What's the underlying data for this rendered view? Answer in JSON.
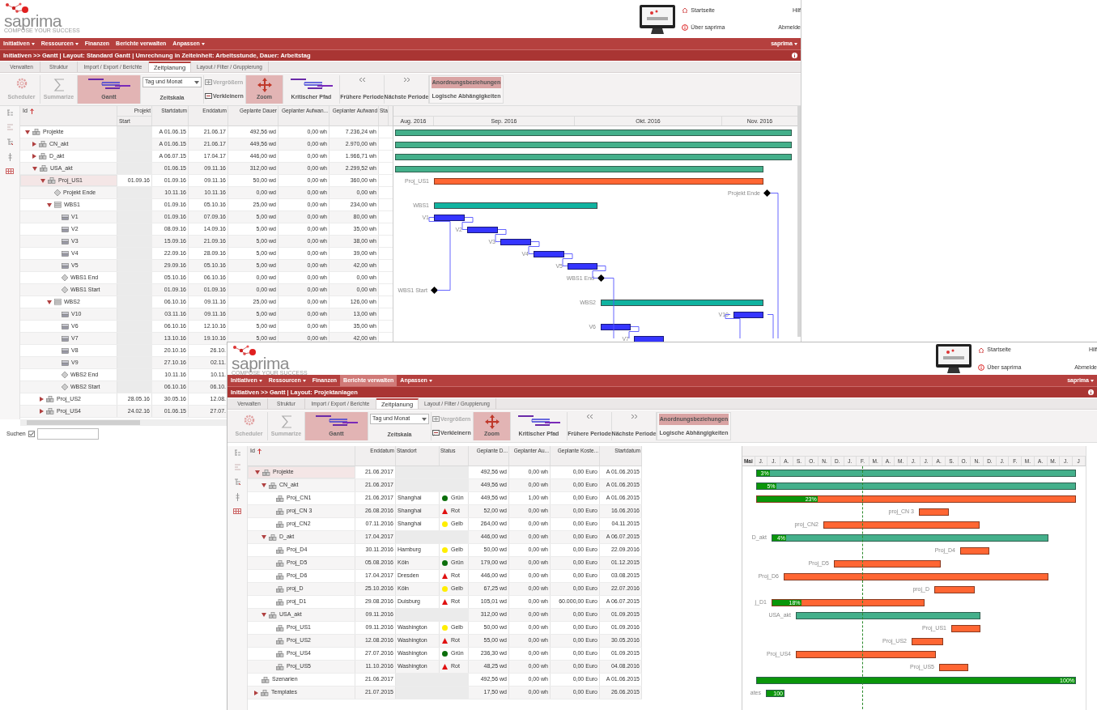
{
  "windows": [
    {
      "logo": {
        "name": "saprima",
        "tagline": "COMPOSE YOUR SUCCESS"
      },
      "header_links": [
        "Startseite",
        "Über saprima"
      ],
      "right_links": [
        "Hilf",
        "Abmelde"
      ],
      "menu": [
        {
          "label": "Initiativen",
          "dropdown": true,
          "selected": false
        },
        {
          "label": "Ressourcen",
          "dropdown": true,
          "selected": false
        },
        {
          "label": "Finanzen",
          "dropdown": false,
          "selected": false
        },
        {
          "label": "Berichte verwalten",
          "dropdown": false,
          "selected": false
        },
        {
          "label": "Anpassen",
          "dropdown": true,
          "selected": false
        }
      ],
      "user_menu": "saprima",
      "breadcrumb": "Initiativen >> Gantt | Layout: Standard Gantt | Umrechnung in Zeiteinheit: Arbeitsstunde, Dauer: Arbeitstag",
      "tabs": [
        {
          "label": "Verwalten",
          "selected": false
        },
        {
          "label": "Struktur",
          "selected": false
        },
        {
          "label": "Import / Export / Berichte",
          "selected": false
        },
        {
          "label": "Zeitplanung",
          "selected": true
        },
        {
          "label": "Layout / Filter / Gruppierung",
          "selected": false
        }
      ],
      "ribbon": [
        {
          "kind": "large",
          "label": "Scheduler",
          "disabled": true,
          "pressed": false
        },
        {
          "kind": "large",
          "label": "Summarize",
          "disabled": true,
          "pressed": false
        },
        {
          "kind": "large",
          "label": "Gantt",
          "disabled": false,
          "pressed": true
        },
        {
          "kind": "select",
          "value": "Tag und Monat",
          "label": "Zeitskala"
        },
        {
          "kind": "pair",
          "items": [
            {
              "label": "Vergrößern",
              "disabled": true
            },
            {
              "label": "Verkleinern",
              "disabled": false
            }
          ]
        },
        {
          "kind": "large",
          "label": "Zoom",
          "disabled": false,
          "pressed": true
        },
        {
          "kind": "large",
          "label": "Kritischer Pfad",
          "disabled": false,
          "pressed": false
        },
        {
          "kind": "large",
          "label": "Frühere Periode",
          "disabled": false,
          "pressed": false
        },
        {
          "kind": "large",
          "label": "Nächste Periode",
          "disabled": false,
          "pressed": false
        },
        {
          "kind": "stack",
          "items": [
            {
              "label": "Anordnungsbeziehungen",
              "pressed": true
            },
            {
              "label": "Logische Abhängigkeiten",
              "pressed": false
            }
          ]
        }
      ],
      "table": {
        "tree_column": {
          "label": "Id",
          "sorted": true
        },
        "columns": [
          {
            "label": "Projekt",
            "sublabel": "Start"
          },
          {
            "label": "Startdatum"
          },
          {
            "label": "Enddatum"
          },
          {
            "label": "Geplante Dauer"
          },
          {
            "label": "Geplanter Aufwan..."
          },
          {
            "label": "Geplanter Aufwand"
          },
          {
            "label": "Sta"
          }
        ],
        "rows": [
          {
            "id": "Projekte",
            "kind": "project",
            "expanded": true,
            "selected": false,
            "cells": [
              null,
              "A 01.06.15",
              "21.06.17",
              "492,56 wd",
              "0,00 wh",
              "7.236,24 wh"
            ],
            "bar": {
              "kind": "summary"
            },
            "children": [
              {
                "id": "CN_akt",
                "kind": "project",
                "expanded": false,
                "selected": false,
                "cells": [
                  null,
                  "A 01.06.15",
                  "21.06.17",
                  "449,56 wd",
                  "0,00 wh",
                  "2.970,00 wh"
                ],
                "bar": {
                  "kind": "summary"
                }
              },
              {
                "id": "D_akt",
                "kind": "project",
                "expanded": false,
                "selected": false,
                "cells": [
                  null,
                  "A 06.07.15",
                  "17.04.17",
                  "446,00 wd",
                  "0,00 wh",
                  "1.966,71 wh"
                ],
                "bar": {
                  "kind": "summary"
                }
              },
              {
                "id": "USA_akt",
                "kind": "project",
                "expanded": true,
                "selected": false,
                "cells": [
                  null,
                  "01.06.15",
                  "09.11.16",
                  "312,00 wd",
                  "0,00 wh",
                  "2.299,52 wh"
                ],
                "bar": {
                  "kind": "summary"
                },
                "children": [
                  {
                    "id": "Proj_US1",
                    "kind": "project",
                    "expanded": true,
                    "selected": true,
                    "cells": [
                      "01.09.16",
                      "01.09.16",
                      "09.11.16",
                      "50,00 wd",
                      "0,00 wh",
                      "360,00 wh"
                    ],
                    "bar": {
                      "kind": "project",
                      "label": "Proj_US1"
                    },
                    "children": [
                      {
                        "id": "Projekt Ende",
                        "kind": "milestone",
                        "selected": false,
                        "cells": [
                          null,
                          "10.11.16",
                          "10.11.16",
                          "0,00 wd",
                          "0,00 wh",
                          "0,00 wh"
                        ],
                        "bar": {
                          "kind": "milestone",
                          "label": "Projekt Ende"
                        }
                      },
                      {
                        "id": "WBS1",
                        "kind": "wbs",
                        "expanded": true,
                        "selected": false,
                        "cells": [
                          null,
                          "01.09.16",
                          "05.10.16",
                          "25,00 wd",
                          "0,00 wh",
                          "234,00 wh"
                        ],
                        "bar": {
                          "kind": "wbs",
                          "label": "WBS1"
                        },
                        "children": [
                          {
                            "id": "V1",
                            "kind": "task",
                            "selected": false,
                            "cells": [
                              null,
                              "01.09.16",
                              "07.09.16",
                              "5,00 wd",
                              "0,00 wh",
                              "80,00 wh"
                            ],
                            "bar": {
                              "kind": "task",
                              "label": "V1"
                            }
                          },
                          {
                            "id": "V2",
                            "kind": "task",
                            "selected": false,
                            "cells": [
                              null,
                              "08.09.16",
                              "14.09.16",
                              "5,00 wd",
                              "0,00 wh",
                              "35,00 wh"
                            ],
                            "bar": {
                              "kind": "task",
                              "label": "V2"
                            }
                          },
                          {
                            "id": "V3",
                            "kind": "task",
                            "selected": false,
                            "cells": [
                              null,
                              "15.09.16",
                              "21.09.16",
                              "5,00 wd",
                              "0,00 wh",
                              "38,00 wh"
                            ],
                            "bar": {
                              "kind": "task",
                              "label": "V3"
                            }
                          },
                          {
                            "id": "V4",
                            "kind": "task",
                            "selected": false,
                            "cells": [
                              null,
                              "22.09.16",
                              "28.09.16",
                              "5,00 wd",
                              "0,00 wh",
                              "39,00 wh"
                            ],
                            "bar": {
                              "kind": "task",
                              "label": "V4"
                            }
                          },
                          {
                            "id": "V5",
                            "kind": "task",
                            "selected": false,
                            "cells": [
                              null,
                              "29.09.16",
                              "05.10.16",
                              "5,00 wd",
                              "0,00 wh",
                              "42,00 wh"
                            ],
                            "bar": {
                              "kind": "task",
                              "label": "V5"
                            }
                          },
                          {
                            "id": "WBS1 End",
                            "kind": "milestone",
                            "selected": false,
                            "cells": [
                              null,
                              "05.10.16",
                              "06.10.16",
                              "0,00 wd",
                              "0,00 wh",
                              "0,00 wh"
                            ],
                            "bar": {
                              "kind": "milestone",
                              "label": "WBS1 End"
                            }
                          },
                          {
                            "id": "WBS1 Start",
                            "kind": "milestone",
                            "selected": false,
                            "cells": [
                              null,
                              "01.09.16",
                              "01.09.16",
                              "0,00 wd",
                              "0,00 wh",
                              "0,00 wh"
                            ],
                            "bar": {
                              "kind": "milestone",
                              "label": "WBS1 Start"
                            }
                          }
                        ]
                      },
                      {
                        "id": "WBS2",
                        "kind": "wbs",
                        "expanded": true,
                        "selected": false,
                        "cells": [
                          null,
                          "06.10.16",
                          "09.11.16",
                          "25,00 wd",
                          "0,00 wh",
                          "126,00 wh"
                        ],
                        "bar": {
                          "kind": "wbs",
                          "label": "WBS2"
                        },
                        "children": [
                          {
                            "id": "V10",
                            "kind": "task",
                            "selected": false,
                            "cells": [
                              null,
                              "03.11.16",
                              "09.11.16",
                              "5,00 wd",
                              "0,00 wh",
                              "13,00 wh"
                            ],
                            "bar": {
                              "kind": "task",
                              "label": "V10"
                            }
                          },
                          {
                            "id": "V6",
                            "kind": "task",
                            "selected": false,
                            "cells": [
                              null,
                              "06.10.16",
                              "12.10.16",
                              "5,00 wd",
                              "0,00 wh",
                              "35,00 wh"
                            ],
                            "bar": {
                              "kind": "task",
                              "label": "V6"
                            }
                          },
                          {
                            "id": "V7",
                            "kind": "task",
                            "selected": false,
                            "cells": [
                              null,
                              "13.10.16",
                              "19.10.16",
                              "5,00 wd",
                              "0,00 wh",
                              "42,00 wh"
                            ],
                            "bar": {
                              "kind": "task",
                              "label": "V7"
                            }
                          },
                          {
                            "id": "V8",
                            "kind": "task",
                            "selected": false,
                            "cells": [
                              null,
                              "20.10.16",
                              "26.10."
                            ]
                          },
                          {
                            "id": "V9",
                            "kind": "task",
                            "selected": false,
                            "cells": [
                              null,
                              "27.10.16",
                              "02.11."
                            ]
                          },
                          {
                            "id": "WBS2 End",
                            "kind": "milestone",
                            "selected": false,
                            "cells": [
                              null,
                              "10.11.16",
                              "10.11."
                            ]
                          },
                          {
                            "id": "WBS2 Start",
                            "kind": "milestone",
                            "selected": false,
                            "cells": [
                              null,
                              "06.10.16",
                              "06.10."
                            ]
                          }
                        ]
                      }
                    ]
                  },
                  {
                    "id": "Proj_US2",
                    "kind": "project",
                    "expanded": false,
                    "selected": false,
                    "cells": [
                      "28.05.16",
                      "30.05.16",
                      "12.08."
                    ]
                  },
                  {
                    "id": "Proj_US4",
                    "kind": "project",
                    "expanded": false,
                    "selected": false,
                    "cells": [
                      "24.02.16",
                      "01.06.15",
                      "27.07."
                    ]
                  }
                ]
              }
            ]
          }
        ]
      },
      "gantt": {
        "months": [
          "Aug. 2016",
          "Sep. 2016",
          "Okt. 2016",
          "Nov. 2016"
        ]
      },
      "search": {
        "label": "Suchen",
        "checked": true
      }
    },
    {
      "logo": {
        "name": "saprima",
        "tagline": "COMPOSE YOUR SUCCESS"
      },
      "header_links": [
        "Startseite",
        "Über saprima"
      ],
      "right_links": [
        "Hilf",
        "Abmelde"
      ],
      "menu": [
        {
          "label": "Initiativen",
          "dropdown": true,
          "selected": false
        },
        {
          "label": "Ressourcen",
          "dropdown": true,
          "selected": false
        },
        {
          "label": "Finanzen",
          "dropdown": false,
          "selected": false
        },
        {
          "label": "Berichte verwalten",
          "dropdown": false,
          "selected": true
        },
        {
          "label": "Anpassen",
          "dropdown": true,
          "selected": false
        }
      ],
      "user_menu": "saprima",
      "breadcrumb": "Initiativen >> Gantt | Layout: Projektanlagen",
      "tabs": [
        {
          "label": "Verwalten",
          "selected": false
        },
        {
          "label": "Struktur",
          "selected": false
        },
        {
          "label": "Import / Export / Berichte",
          "selected": false
        },
        {
          "label": "Zeitplanung",
          "selected": true
        },
        {
          "label": "Layout / Filter / Gruppierung",
          "selected": false
        }
      ],
      "ribbon": [
        {
          "kind": "large",
          "label": "Scheduler",
          "disabled": true,
          "pressed": false
        },
        {
          "kind": "large",
          "label": "Summarize",
          "disabled": true,
          "pressed": false
        },
        {
          "kind": "large",
          "label": "Gantt",
          "disabled": false,
          "pressed": true
        },
        {
          "kind": "select",
          "value": "Tag und Monat",
          "label": "Zeitskala"
        },
        {
          "kind": "pair",
          "items": [
            {
              "label": "Vergrößern",
              "disabled": true
            },
            {
              "label": "Verkleinern",
              "disabled": false
            }
          ]
        },
        {
          "kind": "large",
          "label": "Zoom",
          "disabled": false,
          "pressed": true
        },
        {
          "kind": "large",
          "label": "Kritischer Pfad",
          "disabled": false,
          "pressed": false
        },
        {
          "kind": "large",
          "label": "Frühere Periode",
          "disabled": false,
          "pressed": false
        },
        {
          "kind": "large",
          "label": "Nächste Periode",
          "disabled": false,
          "pressed": false
        },
        {
          "kind": "stack",
          "items": [
            {
              "label": "Anordnungsbeziehungen",
              "pressed": true
            },
            {
              "label": "Logische Abhängigkeiten",
              "pressed": false
            }
          ]
        }
      ],
      "table": {
        "tree_column": {
          "label": "Id",
          "sorted": true
        },
        "columns": [
          {
            "label": "Enddatum"
          },
          {
            "label": "Standort"
          },
          {
            "label": "Status"
          },
          {
            "label": "Geplante D..."
          },
          {
            "label": "Geplanter Au..."
          },
          {
            "label": "Geplante Koste..."
          },
          {
            "label": "Startdatum"
          }
        ],
        "rows": [
          {
            "id": "Projekte",
            "kind": "project",
            "expanded": true,
            "selected": true,
            "cells": [
              "21.06.2017",
              null,
              null,
              "492,56 wd",
              "0,00 wh",
              "0,00 Euro",
              "A 01.06.2015"
            ],
            "bar": {
              "kind": "summary",
              "level": 0.04,
              "progress": "3%"
            },
            "children": [
              {
                "id": "CN_akt",
                "kind": "project",
                "expanded": true,
                "selected": false,
                "cells": [
                  "21.06.2017",
                  null,
                  null,
                  "449,56 wd",
                  "0,00 wh",
                  "0,00 Euro",
                  "A 01.06.2015"
                ],
                "bar": {
                  "kind": "summary",
                  "level": 0.06,
                  "progress": "5%"
                },
                "children": [
                  {
                    "id": "Proj_CN1",
                    "kind": "project",
                    "selected": false,
                    "cells": [
                      "21.06.2017",
                      "Shanghai",
                      {
                        "label": "Grün",
                        "kind": "circle",
                        "color": "#0b6e0b"
                      },
                      "449,56 wd",
                      "1,00 wh",
                      "0,00 Euro",
                      "A 01.06.2015"
                    ],
                    "bar": {
                      "kind": "project",
                      "level": 0.19,
                      "progress": "23%"
                    }
                  },
                  {
                    "id": "proj_CN 3",
                    "kind": "project",
                    "selected": false,
                    "cells": [
                      "26.08.2016",
                      "Shanghai",
                      {
                        "label": "Rot",
                        "kind": "triangle",
                        "color": "#e01010"
                      },
                      "52,00 wd",
                      "0,00 wh",
                      "0,00 Euro",
                      "16.06.2016"
                    ],
                    "bar": {
                      "kind": "project",
                      "label": "proj_CN 3"
                    }
                  },
                  {
                    "id": "proj_CN2",
                    "kind": "project",
                    "selected": false,
                    "cells": [
                      "07.11.2016",
                      "Shanghai",
                      {
                        "label": "Gelb",
                        "kind": "circle",
                        "color": "#ffee00"
                      },
                      "264,00 wd",
                      "0,00 wh",
                      "0,00 Euro",
                      "04.11.2015"
                    ],
                    "bar": {
                      "kind": "project",
                      "label": "proj_CN2"
                    }
                  }
                ]
              },
              {
                "id": "D_akt",
                "kind": "project",
                "expanded": true,
                "selected": false,
                "cells": [
                  "17.04.2017",
                  null,
                  null,
                  "446,00 wd",
                  "0,00 wh",
                  "0,00 Euro",
                  "A 06.07.2015"
                ],
                "bar": {
                  "kind": "summary",
                  "label": "D_akt",
                  "level": 0.05,
                  "progress": "4%"
                },
                "children": [
                  {
                    "id": "Proj_D4",
                    "kind": "project",
                    "selected": false,
                    "cells": [
                      "30.11.2016",
                      "Hamburg",
                      {
                        "label": "Gelb",
                        "kind": "circle",
                        "color": "#ffee00"
                      },
                      "50,00 wd",
                      "0,00 wh",
                      "0,00 Euro",
                      "22.09.2016"
                    ],
                    "bar": {
                      "kind": "project",
                      "label": "Proj_D4"
                    }
                  },
                  {
                    "id": "Proj_D5",
                    "kind": "project",
                    "selected": false,
                    "cells": [
                      "05.08.2016",
                      "Köln",
                      {
                        "label": "Grün",
                        "kind": "circle",
                        "color": "#0b6e0b"
                      },
                      "179,00 wd",
                      "0,00 wh",
                      "0,00 Euro",
                      "01.12.2015"
                    ],
                    "bar": {
                      "kind": "project",
                      "label": "Proj_D5"
                    }
                  },
                  {
                    "id": "Proj_D6",
                    "kind": "project",
                    "selected": false,
                    "cells": [
                      "17.04.2017",
                      "Dresden",
                      {
                        "label": "Rot",
                        "kind": "triangle",
                        "color": "#e01010"
                      },
                      "446,00 wd",
                      "0,00 wh",
                      "0,00 Euro",
                      "03.08.2015"
                    ],
                    "bar": {
                      "kind": "project",
                      "label": "Proj_D6"
                    }
                  },
                  {
                    "id": "proj_D",
                    "kind": "project",
                    "selected": false,
                    "cells": [
                      "25.10.2016",
                      "Köln",
                      {
                        "label": "Gelb",
                        "kind": "circle",
                        "color": "#ffee00"
                      },
                      "67,25 wd",
                      "0,00 wh",
                      "0,00 Euro",
                      "22.07.2016"
                    ],
                    "bar": {
                      "kind": "project",
                      "label": "proj_D"
                    }
                  },
                  {
                    "id": "proj_D1",
                    "kind": "project",
                    "selected": false,
                    "cells": [
                      "29.08.2016",
                      "Duisburg",
                      {
                        "label": "Rot",
                        "kind": "triangle",
                        "color": "#e01010"
                      },
                      "105,01 wd",
                      "0,00 wh",
                      "60.000,00 Euro",
                      "A 06.07.2015"
                    ],
                    "bar": {
                      "kind": "project",
                      "label": "j_D1",
                      "level": 0.19,
                      "progress": "18%"
                    }
                  }
                ]
              },
              {
                "id": "USA_akt",
                "kind": "project",
                "expanded": true,
                "selected": false,
                "cells": [
                  "09.11.2016",
                  null,
                  null,
                  "312,00 wd",
                  "0,00 wh",
                  "0,00 Euro",
                  "01.09.2015"
                ],
                "bar": {
                  "kind": "summary",
                  "label": "USA_akt"
                },
                "children": [
                  {
                    "id": "Proj_US1",
                    "kind": "project",
                    "selected": false,
                    "cells": [
                      "09.11.2016",
                      "Washington",
                      {
                        "label": "Gelb",
                        "kind": "circle",
                        "color": "#ffee00"
                      },
                      "50,00 wd",
                      "0,00 wh",
                      "0,00 Euro",
                      "01.09.2016"
                    ],
                    "bar": {
                      "kind": "project",
                      "label": "Proj_US1"
                    }
                  },
                  {
                    "id": "Proj_US2",
                    "kind": "project",
                    "selected": false,
                    "cells": [
                      "12.08.2016",
                      "Washington",
                      {
                        "label": "Rot",
                        "kind": "triangle",
                        "color": "#e01010"
                      },
                      "55,00 wd",
                      "0,00 wh",
                      "0,00 Euro",
                      "30.05.2016"
                    ],
                    "bar": {
                      "kind": "project",
                      "label": "Proj_US2"
                    }
                  },
                  {
                    "id": "Proj_US4",
                    "kind": "project",
                    "selected": false,
                    "cells": [
                      "27.07.2016",
                      "Washington",
                      {
                        "label": "Grün",
                        "kind": "circle",
                        "color": "#0b6e0b"
                      },
                      "236,30 wd",
                      "0,00 wh",
                      "0,00 Euro",
                      "01.09.2015"
                    ],
                    "bar": {
                      "kind": "project",
                      "label": "Proj_US4"
                    }
                  },
                  {
                    "id": "Proj_US5",
                    "kind": "project",
                    "selected": false,
                    "cells": [
                      "11.10.2016",
                      "Washington",
                      {
                        "label": "Rot",
                        "kind": "triangle",
                        "color": "#e01010"
                      },
                      "48,25 wd",
                      "0,00 wh",
                      "0,00 Euro",
                      "04.08.2016"
                    ],
                    "bar": {
                      "kind": "project",
                      "label": "Proj_US5"
                    }
                  }
                ]
              }
            ]
          },
          {
            "id": "Szenarien",
            "kind": "project",
            "selected": false,
            "cells": [
              "21.06.2017",
              null,
              null,
              "492,56 wd",
              "0,00 wh",
              "0,00 Euro",
              "A 01.06.2015"
            ],
            "bar": {
              "kind": "summary",
              "level": 1,
              "progress": "100%"
            }
          },
          {
            "id": "Templates",
            "kind": "project",
            "expanded": false,
            "selected": false,
            "cells": [
              "21.07.2015",
              null,
              null,
              "17,50 wd",
              "0,00 wh",
              "0,00 Euro",
              "26.06.2015"
            ],
            "bar": {
              "kind": "summary",
              "label": "ates",
              "level": 1,
              "progress": "100"
            }
          }
        ]
      },
      "gantt": {
        "months": [
          "Mai",
          "J.",
          "J.",
          "A.",
          "S.",
          "O.",
          "N.",
          "D.",
          "J.",
          "F.",
          "M.",
          "A.",
          "M.",
          "J.",
          "J.",
          "A.",
          "S.",
          "O.",
          "N.",
          "D.",
          "J.",
          "F.",
          "M.",
          "A.",
          "M.",
          "J.",
          "J"
        ]
      }
    }
  ]
}
